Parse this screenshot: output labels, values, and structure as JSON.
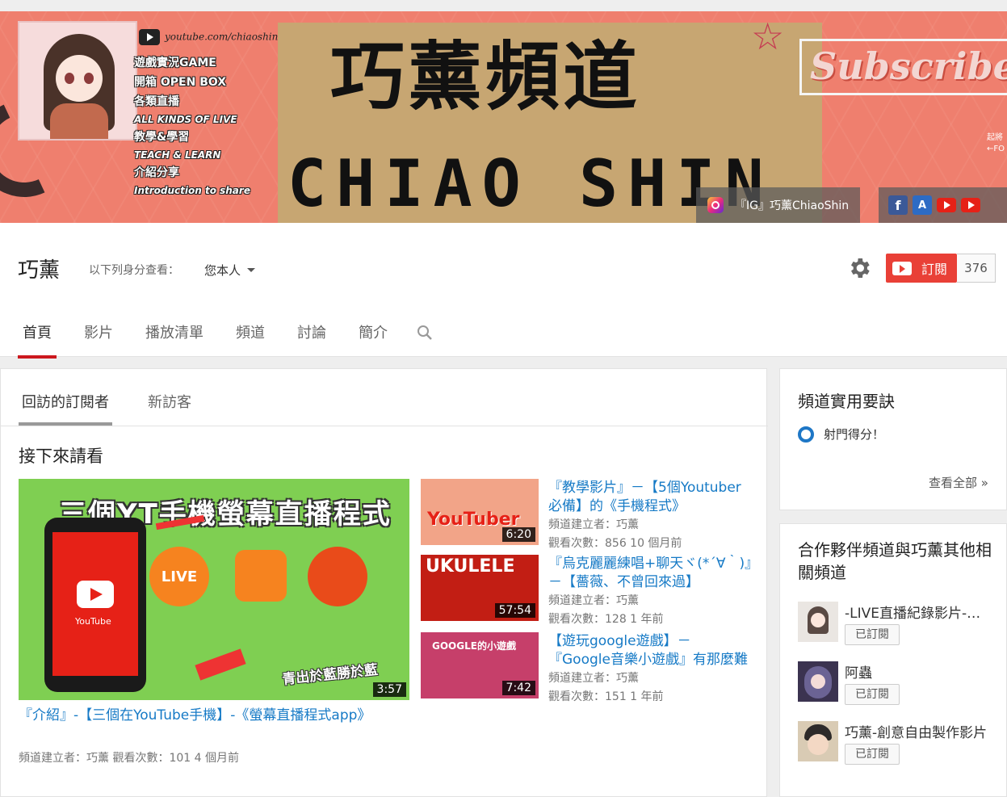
{
  "banner": {
    "url": "youtube.com/chiaoshin",
    "list": [
      "遊戲實況GAME",
      "開箱 OPEN BOX",
      "各類直播",
      "ALL KINDS OF LIVE",
      "教學&學習",
      "TEACH & LEARN",
      "介紹分享",
      "Introduction to share"
    ],
    "title_cn": "巧薰頻道",
    "title_en": "CHIAO SHIN",
    "subscribe_art": "Subscribe",
    "ig_link": "『IG』巧薰ChiaoShin",
    "side_text": "起將\n←FO"
  },
  "channel": {
    "name": "巧薰",
    "view_as_label": "以下列身分查看：",
    "view_as_value": "您本人",
    "subscribe_label": "訂閱",
    "subscriber_count": "376"
  },
  "tabs": [
    "首頁",
    "影片",
    "播放清單",
    "頻道",
    "討論",
    "簡介"
  ],
  "subtabs": [
    "回訪的訂閱者",
    "新訪客"
  ],
  "section_title": "接下來請看",
  "featured": {
    "thumb_title": "三個YT手機螢幕直播程式",
    "thumb_bottom": "青出於藍勝於藍",
    "phone_label": "YouTube",
    "live_label": "LIVE",
    "duration": "3:57",
    "title": "『介紹』-【三個在YouTube手機】-《螢幕直播程式app》",
    "meta": "頻道建立者：巧薰   觀看次數：101   4 個月前"
  },
  "side_videos": [
    {
      "thumb_text": "YouTuber",
      "duration": "6:20",
      "title": "『教學影片』－【5個Youtuber必備】的《手機程式》",
      "creator": "頻道建立者：巧薰",
      "stats": "觀看次數：856   10 個月前"
    },
    {
      "thumb_text": "UKULELE",
      "duration": "57:54",
      "title": "『烏克麗麗練唱+聊天ヾ(*´∀｀)』－【薔薇、不曾回來過】",
      "creator": "頻道建立者：巧薰",
      "stats": "觀看次數：128   1 年前"
    },
    {
      "thumb_text": "GOOGLE的小遊戲",
      "duration": "7:42",
      "title": "【遊玩google遊戲】－『Google音樂小遊戲』有那麼難嗎",
      "creator": "頻道建立者：巧薰",
      "stats": "觀看次數：151   1 年前"
    }
  ],
  "tips": {
    "title": "頻道實用要訣",
    "item": "射門得分！",
    "view_all": "查看全部 »"
  },
  "partners": {
    "title": "合作夥伴頻道與巧薰其他相關頻道",
    "items": [
      {
        "name": "-LIVE直播紀錄影片-巧薰",
        "button": "已訂閱"
      },
      {
        "name": "阿蟲",
        "button": "已訂閱"
      },
      {
        "name": "巧薰-創意自由製作影片",
        "button": "已訂閱"
      }
    ]
  },
  "colors": {
    "banner_bg": "#ef7f6e",
    "accent_red": "#e62117",
    "link_blue": "#167ac6",
    "tab_underline": "#cc181e"
  }
}
